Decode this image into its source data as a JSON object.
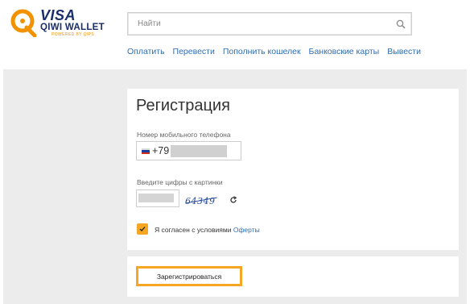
{
  "header": {
    "logo": {
      "visa": "VISA",
      "qiwi": "QIWI WALLET",
      "powered": "POWERED BY QIPS"
    },
    "search": {
      "placeholder": "Найти",
      "icon": "search-icon"
    },
    "nav": [
      "Оплатить",
      "Перевести",
      "Пополнить кошелек",
      "Банковские карты",
      "Вывести"
    ]
  },
  "form": {
    "title": "Регистрация",
    "phone_label": "Номер мобильного телефона",
    "phone_prefix": "+79",
    "captcha_label": "Введите цифры с картинки",
    "captcha_text": "64349",
    "agree_text": "Я согласен с условиями ",
    "agree_link": "Оферты",
    "agree_checked": true,
    "register_label": "Зарегистрироваться"
  },
  "colors": {
    "accent": "#f5a623",
    "link": "#2f6db2",
    "background": "#ececec",
    "brand": "#1a2d6b"
  }
}
